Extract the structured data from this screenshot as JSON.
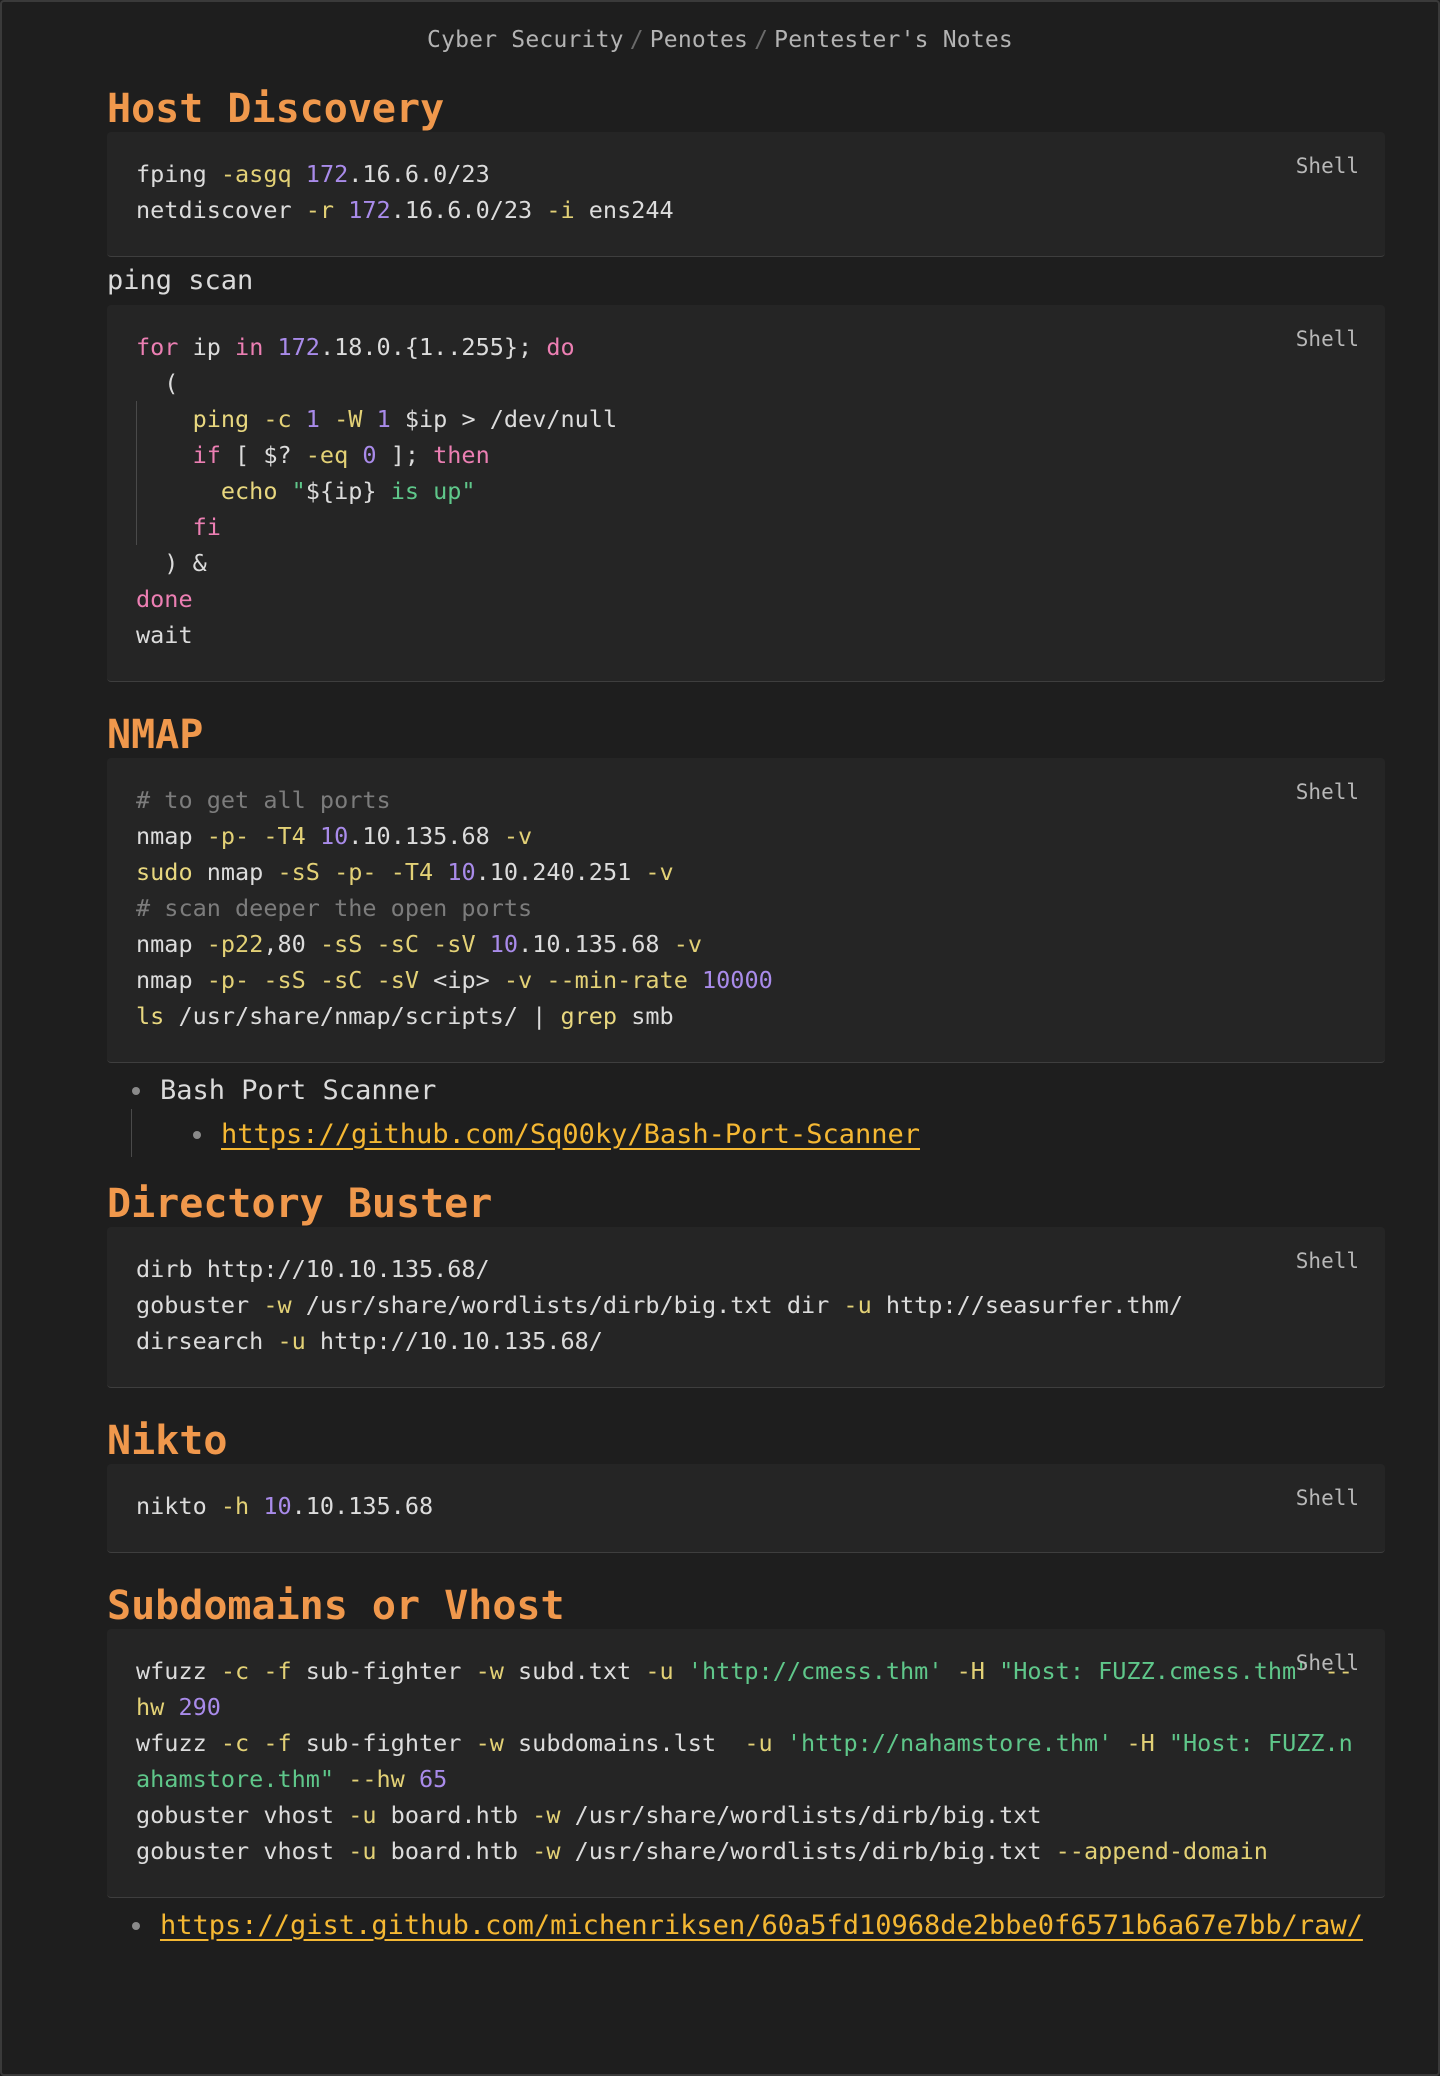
{
  "breadcrumb": {
    "items": [
      "Cyber Security",
      "Penotes",
      "Pentester's Notes"
    ],
    "separator": "/"
  },
  "sections": {
    "host_discovery": {
      "title": "Host Discovery",
      "code1_lang": "Shell",
      "ping_scan_label": "ping scan",
      "code2_lang": "Shell"
    },
    "nmap": {
      "title": "NMAP",
      "code_lang": "Shell",
      "bullet_label": "Bash Port Scanner",
      "bullet_link": "https://github.com/Sq00ky/Bash-Port-Scanner"
    },
    "directory_buster": {
      "title": "Directory Buster",
      "code_lang": "Shell"
    },
    "nikto": {
      "title": "Nikto",
      "code_lang": "Shell"
    },
    "subdomains": {
      "title": "Subdomains or Vhost",
      "code_lang": "Shell",
      "gist_link": "https://gist.github.com/michenriksen/60a5fd10968de2bbe0f6571b6a67e7bb/raw/"
    }
  }
}
